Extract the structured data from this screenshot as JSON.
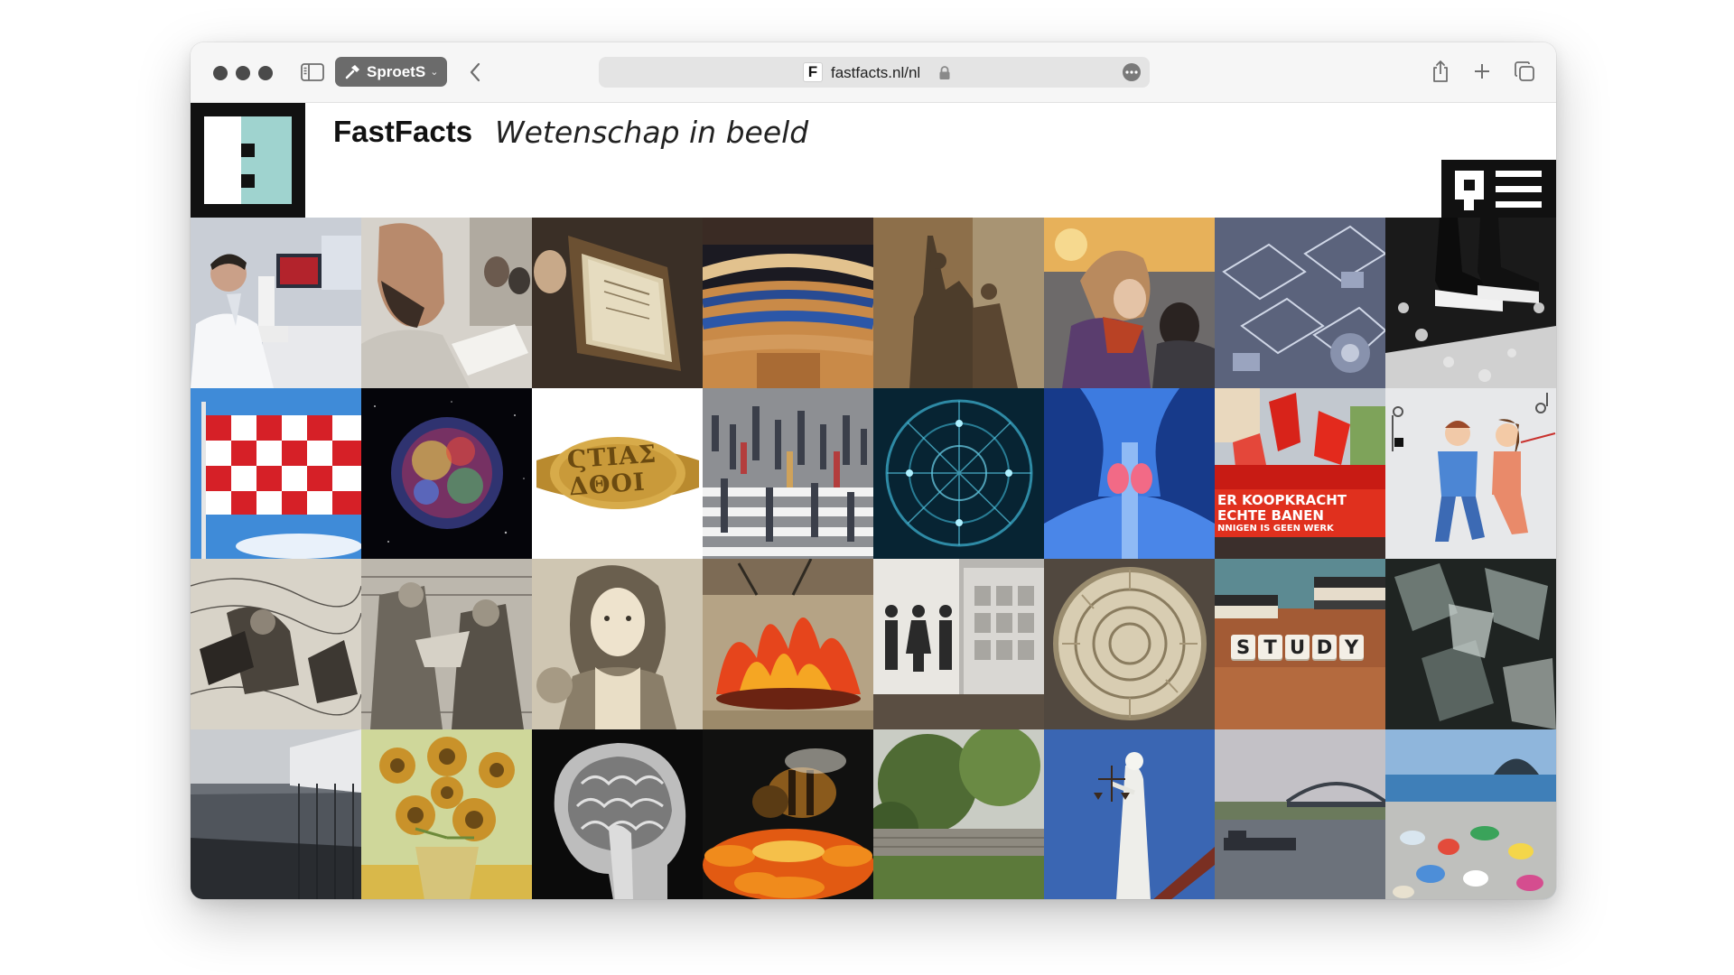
{
  "browser": {
    "profile_label": "SproetS",
    "url": "fastfacts.nl/nl",
    "favicon_letter": "F"
  },
  "site": {
    "title": "FastFacts",
    "tagline": "Wetenschap in beeld",
    "logo_colors": {
      "frame": "#111111",
      "accent": "#9fd3cf"
    }
  },
  "tiles": [
    {
      "name": "tile-lab-microscope"
    },
    {
      "name": "tile-bald-man-writing"
    },
    {
      "name": "tile-old-book"
    },
    {
      "name": "tile-parliament-chamber"
    },
    {
      "name": "tile-bronze-statue"
    },
    {
      "name": "tile-woman-and-child"
    },
    {
      "name": "tile-microchip-structures"
    },
    {
      "name": "tile-sneakers-black-white"
    },
    {
      "name": "tile-brabant-flag"
    },
    {
      "name": "tile-supernova-remnant"
    },
    {
      "name": "tile-gold-ring"
    },
    {
      "name": "tile-crowd-crosswalk"
    },
    {
      "name": "tile-network-sphere"
    },
    {
      "name": "tile-thyroid-xray"
    },
    {
      "name": "tile-protest-march"
    },
    {
      "name": "tile-couple-illustration"
    },
    {
      "name": "tile-engraving-storm"
    },
    {
      "name": "tile-engraving-figures"
    },
    {
      "name": "tile-engraving-woman"
    },
    {
      "name": "tile-burning-fire-painting"
    },
    {
      "name": "tile-restroom-sign"
    },
    {
      "name": "tile-ammonite-fossil"
    },
    {
      "name": "tile-study-blocks"
    },
    {
      "name": "tile-abstract-blur"
    },
    {
      "name": "tile-waterfront-pier"
    },
    {
      "name": "tile-sunflowers-painting"
    },
    {
      "name": "tile-brain-mri"
    },
    {
      "name": "tile-bee-on-flower"
    },
    {
      "name": "tile-garden-wall"
    },
    {
      "name": "tile-lady-justice"
    },
    {
      "name": "tile-river-bridge"
    },
    {
      "name": "tile-plastic-beach"
    }
  ],
  "tile_text": {
    "ring": [
      "ϚΤΙΑΣ",
      "ΔΘΟΙ"
    ],
    "protest_line1": "ER KOOPKRACHT",
    "protest_line2": "ECHTE BANEN",
    "protest_line3": "NNIGEN IS GEEN WERK",
    "study": [
      "S",
      "T",
      "U",
      "D",
      "Y"
    ]
  }
}
